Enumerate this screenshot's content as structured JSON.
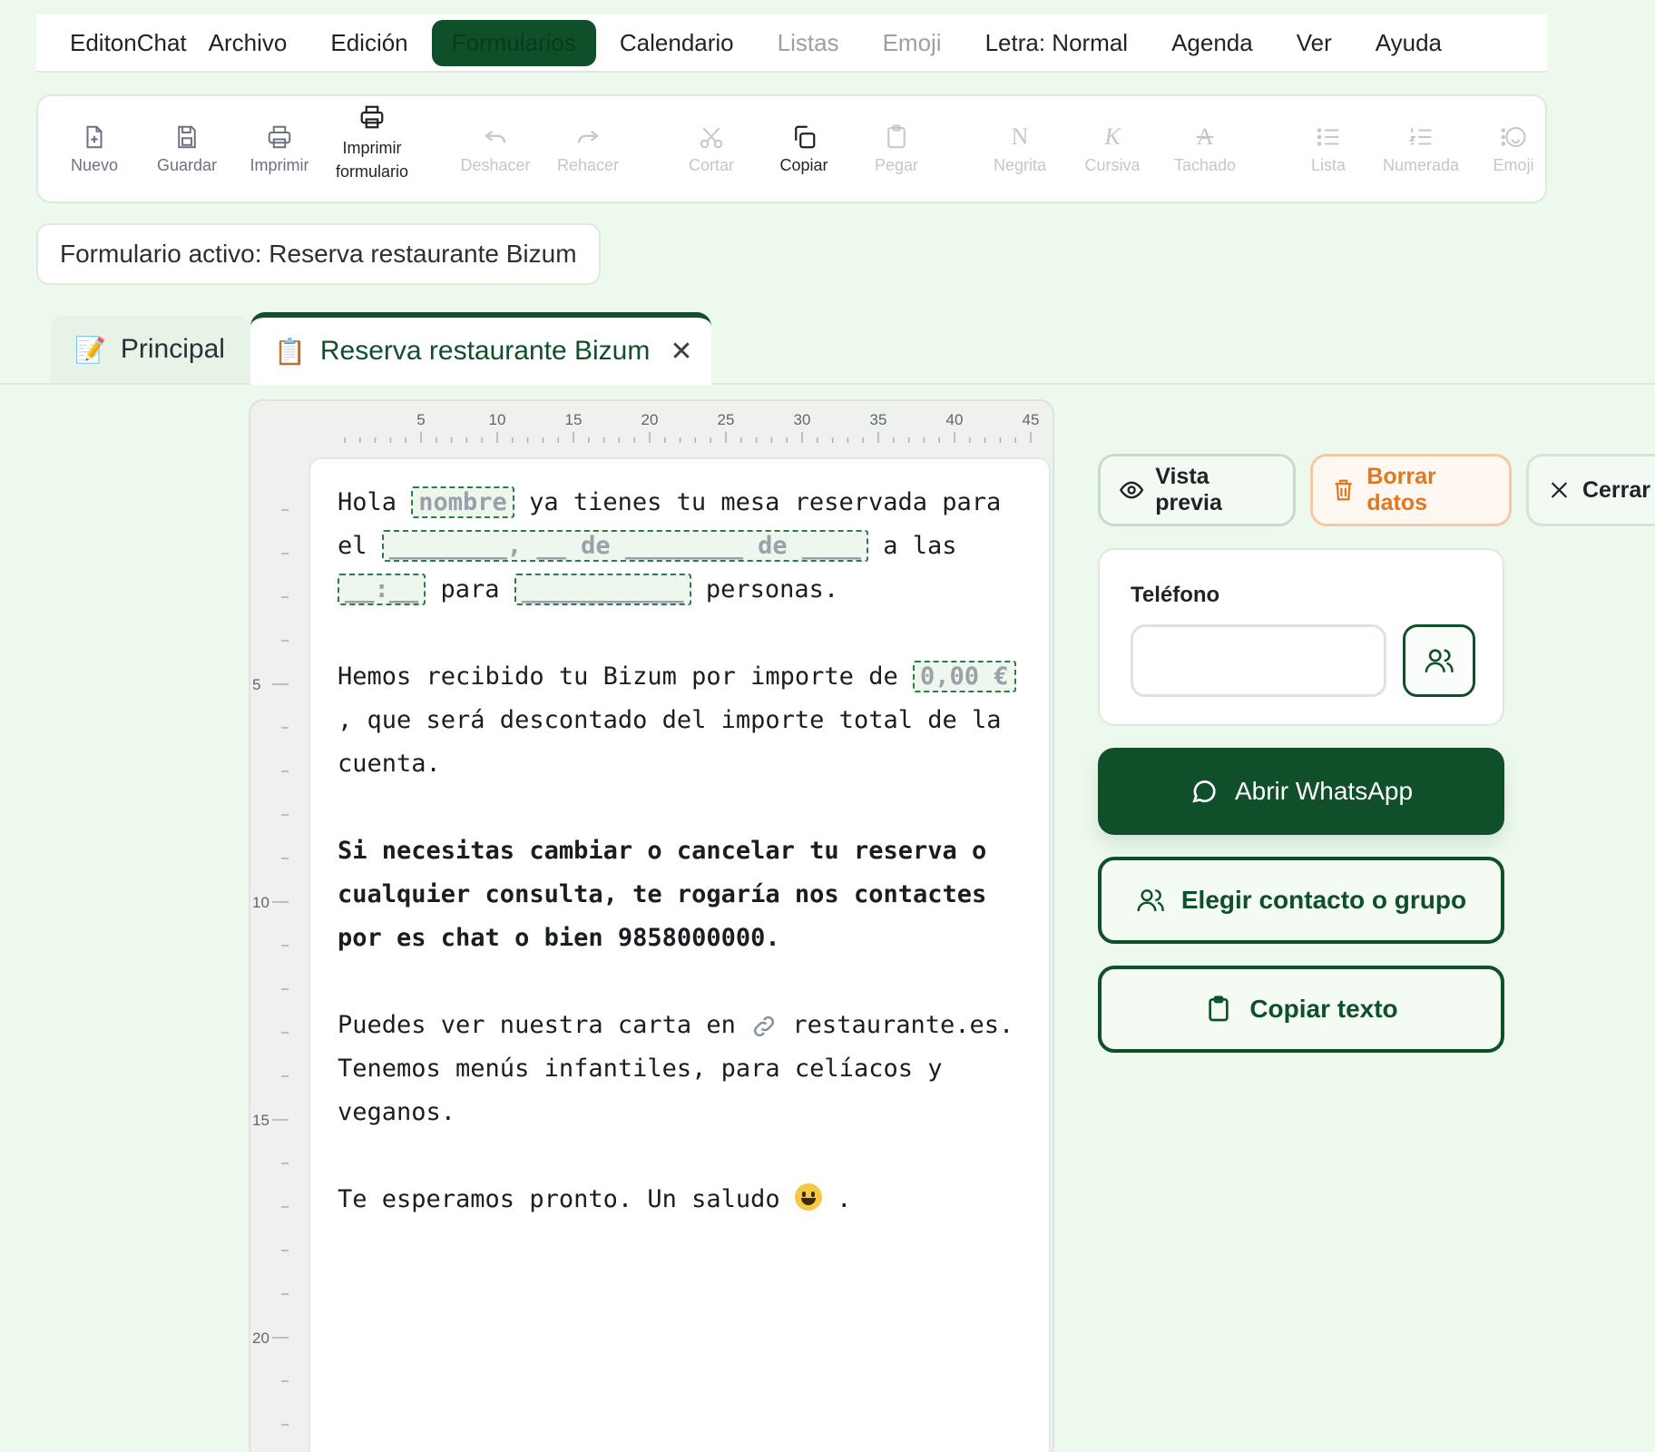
{
  "menu": {
    "items": [
      {
        "label": "EditonChat",
        "state": "brand"
      },
      {
        "label": "Archivo",
        "state": "normal"
      },
      {
        "label": "Edición",
        "state": "normal"
      },
      {
        "label": "Formularios",
        "state": "active"
      },
      {
        "label": "Calendario",
        "state": "normal"
      },
      {
        "label": "Listas",
        "state": "disabled"
      },
      {
        "label": "Emoji",
        "state": "disabled"
      },
      {
        "label": "Letra: Normal",
        "state": "normal"
      },
      {
        "label": "Agenda",
        "state": "normal"
      },
      {
        "label": "Ver",
        "state": "normal"
      },
      {
        "label": "Ayuda",
        "state": "normal"
      }
    ]
  },
  "toolbar": {
    "nuevo": "Nuevo",
    "guardar": "Guardar",
    "imprimir": "Imprimir",
    "imprimir_form_1": "Imprimir",
    "imprimir_form_2": "formulario",
    "deshacer": "Deshacer",
    "rehacer": "Rehacer",
    "cortar": "Cortar",
    "copiar": "Copiar",
    "pegar": "Pegar",
    "negrita": "Negrita",
    "negrita_glyph": "N",
    "cursiva": "Cursiva",
    "cursiva_glyph": "K",
    "tachado": "Tachado",
    "tachado_glyph": "A",
    "lista": "Lista",
    "numerada": "Numerada",
    "emoji": "Emoji"
  },
  "active_form": "Formulario activo: Reserva restaurante Bizum",
  "tabs": [
    {
      "label": "Principal",
      "emoji": "📝",
      "active": false
    },
    {
      "label": "Reserva restaurante Bizum",
      "emoji": "📋",
      "active": true,
      "close": "✕"
    }
  ],
  "ruler": {
    "h_labels": [
      "5",
      "10",
      "15",
      "20",
      "25",
      "30",
      "35",
      "40",
      "45"
    ],
    "v_labels": [
      "5",
      "10",
      "15",
      "20"
    ]
  },
  "document": {
    "p1_a": "Hola ",
    "p1_field_name": "nombre",
    "p1_b": " ya tienes tu mesa reservada para el ",
    "p1_field_date": "________, __ de ________ de ____",
    "p1_c": " a las ",
    "p1_field_time": "__:__",
    "p1_d": " para ",
    "p1_field_people": "___________",
    "p1_e": " personas.",
    "p2_a": "Hemos recibido tu Bizum por importe de ",
    "p2_field_amount": "0,00 €",
    "p2_b": " , que será descontado del importe total de la cuenta.",
    "p3": "Si necesitas cambiar o cancelar tu reserva o cualquier consulta, te rogaría nos contactes por es chat o bien 9858000000.",
    "p4_a": "Puedes ver nuestra carta en ",
    "p4_b": "restaurante.es. Tenemos menús infantiles, para celíacos y veganos.",
    "p5_a": "Te esperamos pronto. Un saludo ",
    "p5_b": " ."
  },
  "actions": {
    "preview": "Vista previa",
    "delete": "Borrar datos",
    "close": "Cerrar",
    "phone_label": "Teléfono",
    "phone_value": "",
    "whatsapp": "Abrir WhatsApp",
    "choose_contact": "Elegir contacto o grupo",
    "copy_text": "Copiar texto"
  },
  "colors": {
    "accent": "#0f4f2a",
    "background": "#eef9ee",
    "delete": "#e0781f"
  }
}
